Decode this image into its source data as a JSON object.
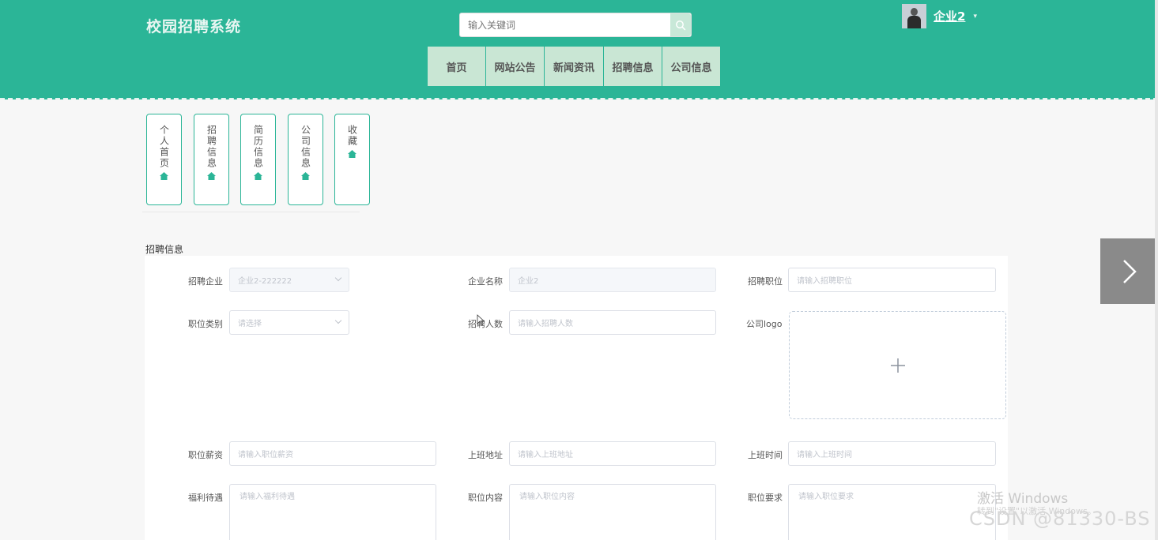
{
  "header": {
    "site_title": "校园招聘系统",
    "search_placeholder": "输入关键词",
    "username": "企业2",
    "caret": "▾"
  },
  "nav": {
    "items": [
      "首页",
      "网站公告",
      "新闻资讯",
      "招聘信息",
      "公司信息"
    ]
  },
  "side_menu": {
    "items": [
      "个人首页",
      "招聘信息",
      "简历信息",
      "公司信息",
      "收藏"
    ]
  },
  "section": {
    "title": "招聘信息"
  },
  "form": {
    "company_label": "招聘企业",
    "company_value": "企业2-222222",
    "company_name_label": "企业名称",
    "company_name_value": "企业2",
    "position_label": "招聘职位",
    "position_placeholder": "请输入招聘职位",
    "category_label": "职位类别",
    "category_placeholder": "请选择",
    "headcount_label": "招聘人数",
    "headcount_placeholder": "请输入招聘人数",
    "logo_label": "公司logo",
    "salary_label": "职位薪资",
    "salary_placeholder": "请输入职位薪资",
    "address_label": "上班地址",
    "address_placeholder": "请输入上班地址",
    "worktime_label": "上班时间",
    "worktime_placeholder": "请输入上班时间",
    "benefits_label": "福利待遇",
    "benefits_placeholder": "请输入福利待遇",
    "content_label": "职位内容",
    "content_placeholder": "请输入职位内容",
    "requirements_label": "职位要求",
    "requirements_placeholder": "请输入职位要求"
  },
  "watermarks": {
    "windows_title": "激活 Windows",
    "windows_sub": "转到\"设置\"以激活 Windows。",
    "csdn": "CSDN @81330-BS"
  },
  "colors": {
    "header_bg": "#2bb597",
    "nav_item_bg": "#c9e6d4",
    "menu_border": "#2bb597"
  }
}
